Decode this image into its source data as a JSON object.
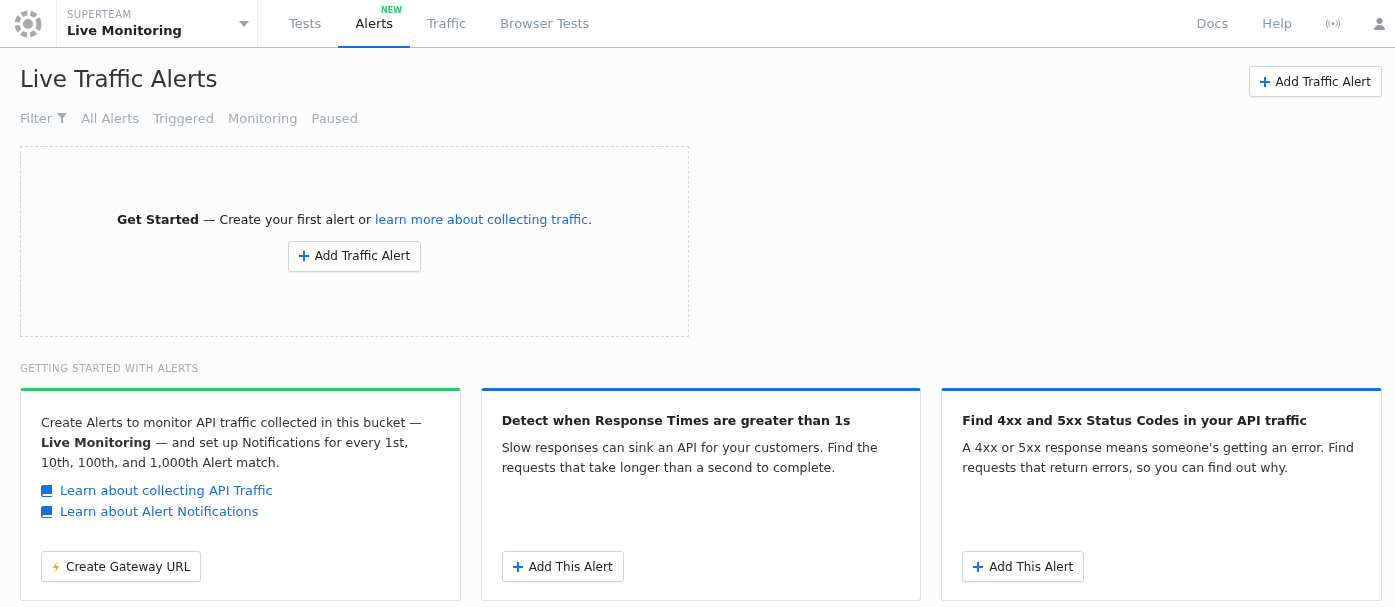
{
  "header": {
    "team": "SUPERTEAM",
    "bucket": "Live Monitoring",
    "tabs": [
      {
        "label": "Tests",
        "selected": false
      },
      {
        "label": "Alerts",
        "selected": true,
        "badge": "NEW"
      },
      {
        "label": "Traffic",
        "selected": false
      },
      {
        "label": "Browser Tests",
        "selected": false
      }
    ],
    "links": [
      "Docs",
      "Help"
    ]
  },
  "page": {
    "title": "Live Traffic Alerts",
    "add_button": "Add Traffic Alert",
    "filter": {
      "label": "Filter",
      "options": [
        "All Alerts",
        "Triggered",
        "Monitoring",
        "Paused"
      ]
    }
  },
  "empty_state": {
    "lead": "Get Started",
    "text": " — Create your first alert or ",
    "link": "learn more about collecting traffic",
    "end": ".",
    "button": "Add Traffic Alert"
  },
  "section_label": "GETTING STARTED WITH ALERTS",
  "cards": [
    {
      "color": "#2ecc71",
      "body": "Create Alerts to monitor API traffic collected in this bucket — **Live Monitoring** — and set up Notifications for every 1st, 10th, 100th, and 1,000th Alert match.",
      "links": [
        "Learn about collecting API Traffic",
        "Learn about Alert Notifications"
      ],
      "button": {
        "kind": "bolt",
        "label": "Create Gateway URL"
      }
    },
    {
      "color": "#1a6fe0",
      "title": "Detect when Response Times are greater than 1s",
      "body": "Slow responses can sink an API for your customers. Find the requests that take longer than a second to complete.",
      "button": {
        "kind": "plus",
        "label": "Add This Alert"
      }
    },
    {
      "color": "#1a6fe0",
      "title": "Find 4xx and 5xx Status Codes in your API traffic",
      "body": "A 4xx or 5xx response means someone's getting an error. Find requests that return errors, so you can find out why.",
      "button": {
        "kind": "plus",
        "label": "Add This Alert"
      }
    }
  ]
}
